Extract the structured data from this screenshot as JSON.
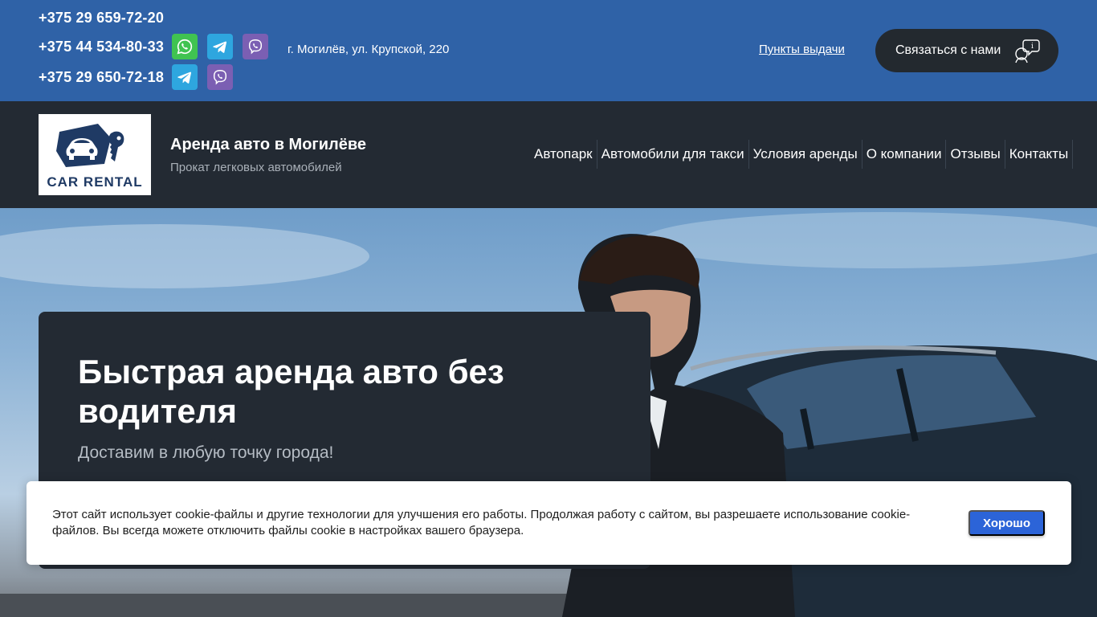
{
  "topbar": {
    "phones": [
      "+375 29 659-72-20",
      "+375 44 534-80-33",
      "+375 29 650-72-18"
    ],
    "address": "г. Могилёв, ул. Крупской, 220",
    "pickup_link": "Пункты выдачи",
    "contact_button": "Связаться с нами"
  },
  "header": {
    "logo_text": "CAR RENTAL",
    "title": "Аренда авто в Могилёве",
    "subtitle": "Прокат легковых автомобилей",
    "nav": [
      "Автопарк",
      "Автомобили для такси",
      "Условия аренды",
      "О компании",
      "Отзывы",
      "Контакты"
    ]
  },
  "hero": {
    "title": "Быстрая аренда авто без водителя",
    "subtitle": "Доставим в любую точку города!"
  },
  "cookie": {
    "text": "Этот сайт использует cookie-файлы и другие технологии для улучшения его работы. Продолжая работу с сайтом, вы разрешаете использование cookie-файлов. Вы всегда можете отключить файлы cookie в настройках вашего браузера.",
    "button": "Хорошо"
  },
  "colors": {
    "topbar": "#2f62a7",
    "header": "#232a33",
    "whatsapp": "#40c351",
    "telegram": "#2ea6df",
    "viber": "#7b5fb3",
    "cookie_button": "#2c64d8"
  }
}
